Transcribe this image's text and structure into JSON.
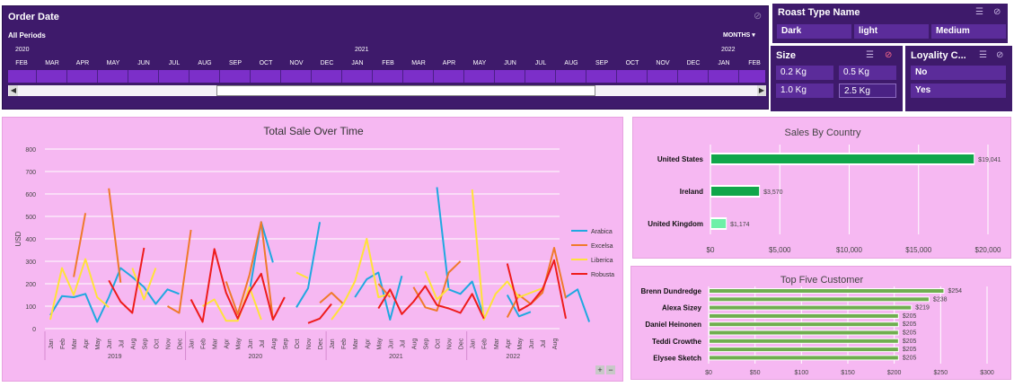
{
  "timeline": {
    "title": "Order Date",
    "all_periods": "All Periods",
    "unit": "MONTHS",
    "years": [
      "2020",
      "2021",
      "2022"
    ],
    "months": [
      "FEB",
      "MAR",
      "APR",
      "MAY",
      "JUN",
      "JUL",
      "AUG",
      "SEP",
      "OCT",
      "NOV",
      "DEC",
      "JAN",
      "FEB",
      "MAR",
      "APR",
      "MAY",
      "JUN",
      "JUL",
      "AUG",
      "SEP",
      "OCT",
      "NOV",
      "DEC",
      "JAN",
      "FEB"
    ]
  },
  "roast_slicer": {
    "title": "Roast Type Name",
    "items": [
      "Dark",
      "light",
      "Medium"
    ]
  },
  "size_slicer": {
    "title": "Size",
    "items": [
      "0.2 Kg",
      "0.5 Kg",
      "1.0 Kg",
      "2.5 Kg"
    ]
  },
  "loyalty_slicer": {
    "title": "Loyality C...",
    "items": [
      "No",
      "Yes"
    ]
  },
  "chart_data": [
    {
      "type": "line",
      "title": "Total Sale Over Time",
      "ylabel": "USD",
      "ylim": [
        0,
        800
      ],
      "yticks": [
        "0",
        "100",
        "200",
        "300",
        "400",
        "500",
        "600",
        "700",
        "800"
      ],
      "months": [
        "Jan",
        "Feb",
        "Mar",
        "Apr",
        "May",
        "Jun",
        "Jul",
        "Aug",
        "Sep",
        "Oct",
        "Nov",
        "Dec",
        "Jan",
        "Feb",
        "Mar",
        "Apr",
        "May",
        "Jun",
        "Jul",
        "Aug",
        "Sep",
        "Oct",
        "Nov",
        "Dec",
        "Jan",
        "Feb",
        "Mar",
        "Apr",
        "May",
        "Jun",
        "Jul",
        "Aug",
        "Sep",
        "Oct",
        "Nov",
        "Dec",
        "Jan",
        "Feb",
        "Mar",
        "Apr",
        "May",
        "Jun",
        "Jul",
        "Aug"
      ],
      "years": [
        "2019",
        "2020",
        "2021",
        "2022"
      ],
      "series": [
        {
          "name": "Arabica",
          "color": "#1fa8e0",
          "values": [
            60,
            145,
            140,
            155,
            30,
            140,
            270,
            230,
            185,
            110,
            175,
            155,
            null,
            null,
            null,
            null,
            null,
            165,
            475,
            295,
            null,
            95,
            180,
            475,
            null,
            null,
            140,
            220,
            250,
            40,
            235,
            null,
            null,
            630,
            175,
            155,
            210,
            55,
            null,
            150,
            55,
            75,
            null,
            null,
            140,
            175,
            30
          ]
        },
        {
          "name": "Excelsa",
          "color": "#ef7a2b",
          "values": [
            null,
            null,
            230,
            515,
            null,
            625,
            205,
            null,
            null,
            null,
            100,
            70,
            440,
            null,
            null,
            210,
            65,
            240,
            475,
            40,
            null,
            null,
            null,
            115,
            160,
            110,
            null,
            null,
            200,
            140,
            null,
            185,
            95,
            80,
            250,
            300,
            null,
            null,
            null,
            50,
            150,
            110,
            160,
            360,
            135
          ]
        },
        {
          "name": "Liberica",
          "color": "#ffe23a",
          "values": [
            40,
            270,
            150,
            310,
            140,
            95,
            null,
            270,
            130,
            270,
            null,
            null,
            null,
            100,
            130,
            35,
            35,
            185,
            40,
            null,
            null,
            250,
            225,
            null,
            40,
            110,
            210,
            400,
            140,
            155,
            null,
            null,
            255,
            130,
            180,
            null,
            620,
            40,
            155,
            210,
            140,
            160,
            180,
            null,
            null
          ]
        },
        {
          "name": "Robusta",
          "color": "#ee1c1c",
          "values": [
            null,
            null,
            null,
            null,
            null,
            215,
            120,
            70,
            360,
            null,
            null,
            null,
            130,
            30,
            355,
            160,
            45,
            165,
            245,
            40,
            140,
            null,
            25,
            45,
            110,
            null,
            null,
            null,
            90,
            175,
            65,
            120,
            190,
            105,
            90,
            70,
            155,
            45,
            null,
            290,
            80,
            110,
            175,
            305,
            45
          ]
        }
      ]
    },
    {
      "type": "bar",
      "title": "Sales By Country",
      "categories": [
        "United States",
        "Ireland",
        "United Kingdom"
      ],
      "values": [
        19041,
        3570,
        1174
      ],
      "data_labels": [
        "$19,041",
        "$3,570",
        "$1,174"
      ],
      "xlim": [
        0,
        20000
      ],
      "xticks": [
        "$0",
        "$5,000",
        "$10,000",
        "$15,000",
        "$20,000"
      ],
      "colors": [
        "#10a64a",
        "#10a64a",
        "#6ff0a8"
      ]
    },
    {
      "type": "bar",
      "title": "Top Five Customer",
      "categories": [
        "Brenn Dundredge",
        "",
        "Alexa Sizey",
        "",
        "Daniel Heinonen",
        "",
        "Teddi Crowthe",
        "",
        "Elysee Sketch"
      ],
      "values": [
        254,
        238,
        219,
        205,
        205,
        205,
        205,
        205,
        205
      ],
      "data_labels": [
        "$254",
        "$238",
        "$219",
        "$205",
        "$205",
        "$205",
        "$205",
        "$205",
        "$205"
      ],
      "xlim": [
        0,
        300
      ],
      "xticks": [
        "$0",
        "$50",
        "$100",
        "$150",
        "$200",
        "$250",
        "$300"
      ],
      "color": "#6fae4f"
    }
  ]
}
